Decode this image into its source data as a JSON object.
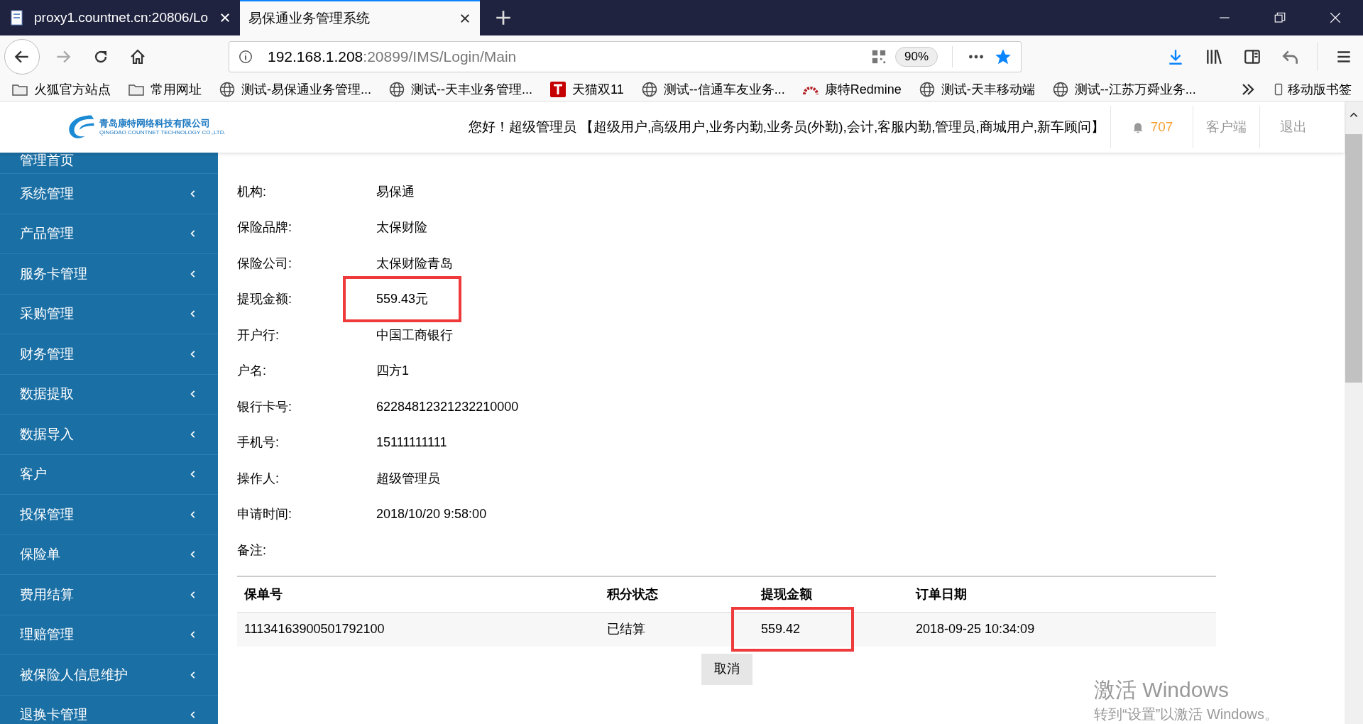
{
  "browser": {
    "tabs": [
      {
        "title": "proxy1.countnet.cn:20806/Lo",
        "selected": false
      },
      {
        "title": "易保通业务管理系统",
        "selected": true
      }
    ],
    "url": {
      "host": "192.168.1.208",
      "rest": ":20899/IMS/Login/Main"
    },
    "zoom": "90%",
    "bookmarks": [
      {
        "kind": "folder",
        "label": "火狐官方站点"
      },
      {
        "kind": "folder",
        "label": "常用网址"
      },
      {
        "kind": "globe",
        "label": "测试-易保通业务管理..."
      },
      {
        "kind": "globe",
        "label": "测试--天丰业务管理..."
      },
      {
        "kind": "tmall",
        "label": "天猫双11"
      },
      {
        "kind": "globe",
        "label": "测试--信通车友业务..."
      },
      {
        "kind": "redmine",
        "label": "康特Redmine"
      },
      {
        "kind": "globe",
        "label": "测试-天丰移动端"
      },
      {
        "kind": "globe",
        "label": "测试--江苏万舜业务..."
      }
    ],
    "mobile_bookmarks": "移动版书签"
  },
  "header": {
    "logo_cn": "青岛康特网络科技有限公司",
    "logo_en": "QINGDAO COUNTNET TECHNOLOGY CO.,LTD.",
    "greeting": "您好！超级管理员 【超级用户,高级用户,业务内勤,业务员(外勤),会计,客服内勤,管理员,商城用户,新车顾问】",
    "notifications": "707",
    "links": [
      "客户端",
      "退出"
    ]
  },
  "sidebar": {
    "items": [
      "管理首页",
      "系统管理",
      "产品管理",
      "服务卡管理",
      "采购管理",
      "财务管理",
      "数据提取",
      "数据导入",
      "客户",
      "投保管理",
      "保险单",
      "费用结算",
      "理赔管理",
      "被保险人信息维护",
      "退换卡管理"
    ]
  },
  "details": [
    {
      "label": "机构:",
      "value": "易保通",
      "highlighted": false
    },
    {
      "label": "保险品牌:",
      "value": "太保财险",
      "highlighted": false
    },
    {
      "label": "保险公司:",
      "value": "太保财险青岛",
      "highlighted": false
    },
    {
      "label": "提现金额:",
      "value": "559.43元",
      "highlighted": true
    },
    {
      "label": "开户行:",
      "value": "中国工商银行",
      "highlighted": false
    },
    {
      "label": "户名:",
      "value": "四方1",
      "highlighted": false
    },
    {
      "label": "银行卡号:",
      "value": "62284812321232210000",
      "highlighted": false
    },
    {
      "label": "手机号:",
      "value": "15111111111",
      "highlighted": false
    },
    {
      "label": "操作人:",
      "value": "超级管理员",
      "highlighted": false
    },
    {
      "label": "申请时间:",
      "value": "2018/10/20 9:58:00",
      "highlighted": false
    },
    {
      "label": "备注:",
      "highlighted": false
    }
  ],
  "table": {
    "columns": [
      "保单号",
      "积分状态",
      "提现金额",
      "订单日期"
    ],
    "rows": [
      {
        "cells": [
          {
            "text": "11134163900501792100",
            "highlighted": false
          },
          {
            "text": "已结算",
            "highlighted": false
          },
          {
            "text": "559.42",
            "highlighted": true
          },
          {
            "text": "2018-09-25 10:34:09",
            "highlighted": false
          }
        ]
      }
    ]
  },
  "cancel_button": "取消",
  "activation": {
    "title": "激活 Windows",
    "hint": "转到“设置”以激活 Windows。"
  }
}
